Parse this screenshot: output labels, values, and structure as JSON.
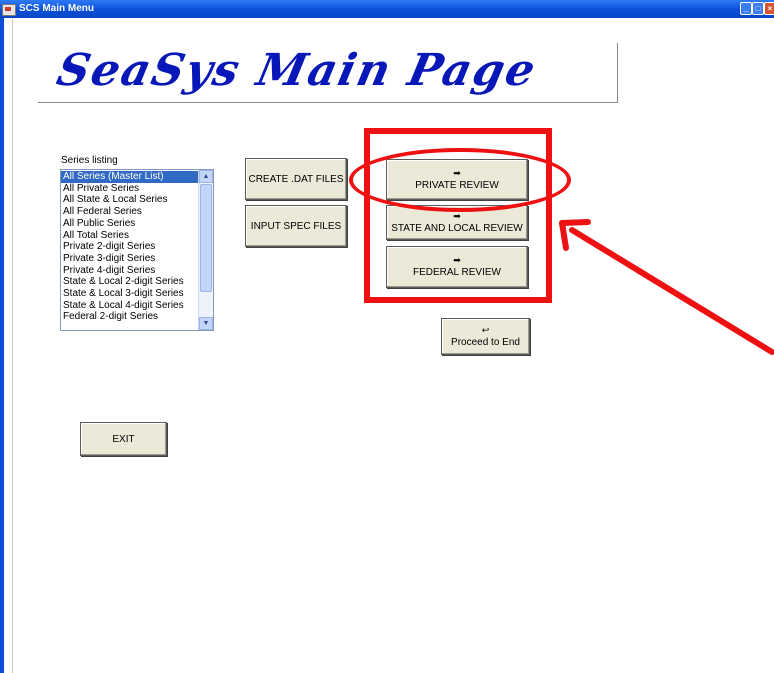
{
  "window": {
    "title": "SCS Main Menu"
  },
  "banner": {
    "title": "SeaSys Main Page"
  },
  "series": {
    "label": "Series listing",
    "items": [
      "All Series (Master List)",
      "All Private Series",
      "All State & Local Series",
      "All Federal Series",
      "All Public Series",
      "All Total Series",
      "Private 2-digit Series",
      "Private 3-digit Series",
      "Private 4-digit Series",
      "State & Local 2-digit Series",
      "State & Local 3-digit Series",
      "State & Local 4-digit Series",
      "Federal 2-digit Series"
    ],
    "selected_index": 0
  },
  "buttons": {
    "create_dat": "CREATE .DAT FILES",
    "input_spec": "INPUT SPEC FILES",
    "private_review": "PRIVATE REVIEW",
    "state_local_review": "STATE AND LOCAL REVIEW",
    "federal_review": "FEDERAL REVIEW",
    "proceed": "Proceed to End",
    "exit": "EXIT"
  },
  "colors": {
    "annotation": "#ee1111",
    "banner_text": "#0717b8",
    "selection": "#316ac5"
  },
  "icons": {
    "review_arrow": "right-arrow-icon",
    "proceed": "return-arrow-icon"
  }
}
